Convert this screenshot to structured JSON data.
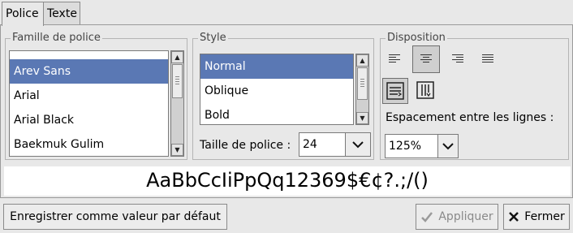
{
  "tabs": [
    {
      "label": "Police",
      "active": true
    },
    {
      "label": "Texte",
      "active": false
    }
  ],
  "font_family": {
    "title": "Famille de police",
    "items": [
      "Arev Sans",
      "Arial",
      "Arial Black",
      "Baekmuk Gulim"
    ],
    "selected": "Arev Sans"
  },
  "style": {
    "title": "Style",
    "items": [
      "Normal",
      "Oblique",
      "Bold"
    ],
    "selected": "Normal",
    "size_label": "Taille de police :",
    "size_value": "24"
  },
  "disposition": {
    "title": "Disposition",
    "alignment_icons": [
      "align-left-icon",
      "align-center-icon",
      "align-right-icon",
      "align-justify-icon"
    ],
    "active_alignment": "align-center-icon",
    "line_spacing_label": "Espacement entre les lignes :",
    "line_spacing_value": "125%"
  },
  "preview": {
    "text": "AaBbCcIiPpQq12369$€¢?.;/()"
  },
  "buttons": {
    "save_default": "Enregistrer comme valeur par défaut",
    "apply": "Appliquer",
    "close": "Fermer"
  }
}
